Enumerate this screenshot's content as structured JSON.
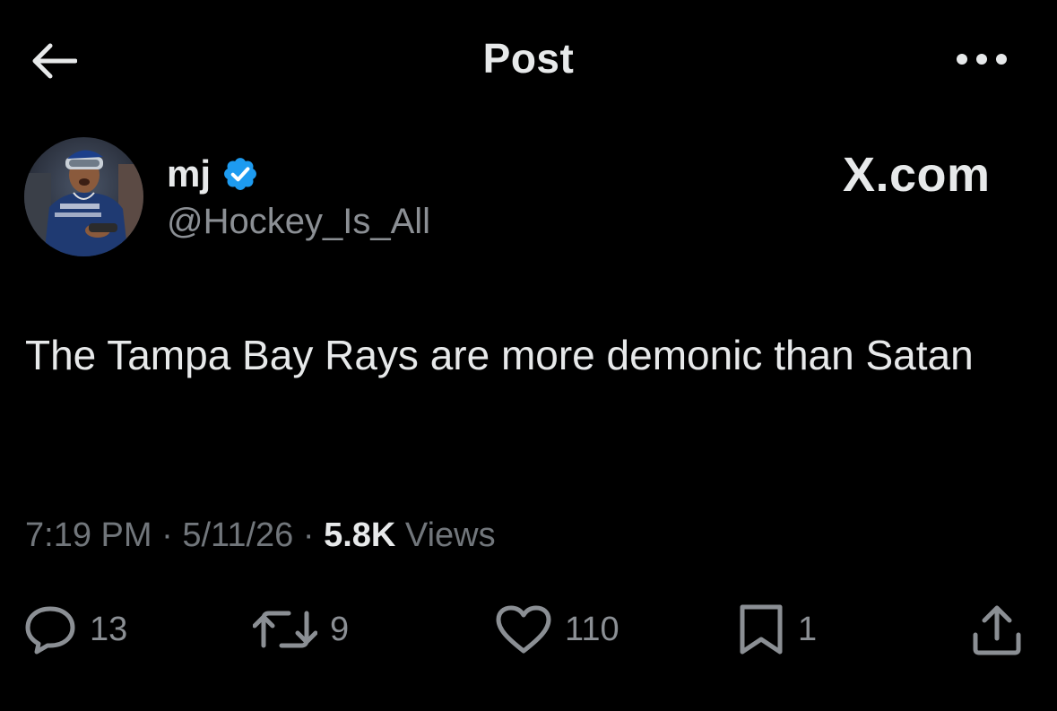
{
  "header": {
    "title": "Post"
  },
  "author": {
    "display_name": "mj",
    "handle": "@Hockey_Is_All",
    "verified": true,
    "verified_color": "#1d9bf0"
  },
  "watermark": "X.com",
  "post": {
    "text": "The Tampa Bay Rays are more demonic than Satan",
    "time": "7:19 PM",
    "date": "5/11/26",
    "separator": "·",
    "views_count": "5.8K",
    "views_label": "Views"
  },
  "actions": {
    "replies": "13",
    "reposts": "9",
    "likes": "110",
    "bookmarks": "1"
  },
  "icons": {
    "back": "arrow-left-icon",
    "more": "more-horizontal-icon",
    "verified": "verified-badge-icon",
    "reply": "reply-icon",
    "repost": "repost-icon",
    "like": "heart-icon",
    "bookmark": "bookmark-icon",
    "share": "share-icon"
  }
}
